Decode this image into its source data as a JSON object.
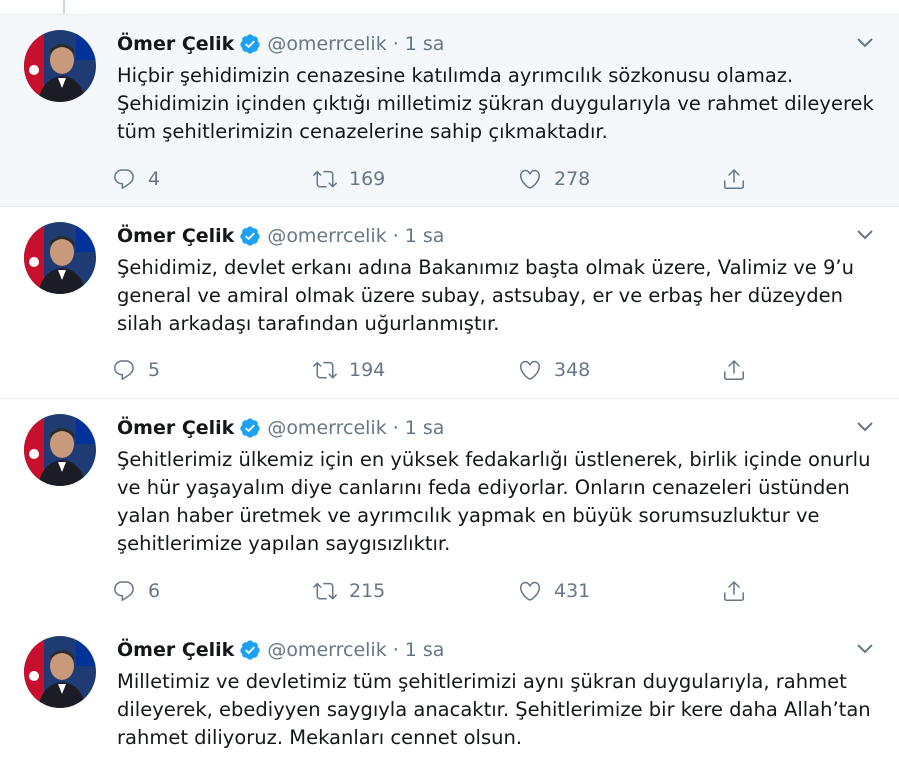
{
  "tweets": [
    {
      "author": "Ömer Çelik",
      "handle": "@omerrcelik",
      "separator": "·",
      "time": "1 sa",
      "text": [
        "Hiçbir şehidimizin cenazesine katılımda ayrımcılık sözkonusu olamaz.",
        "Şehidimizin içinden çıktığı milletimiz şükran duygularıyla ve rahmet dileyerek",
        "tüm şehitlerimizin cenazelerine sahip çıkmaktadır."
      ],
      "replies": "4",
      "retweets": "169",
      "likes": "278"
    },
    {
      "author": "Ömer Çelik",
      "handle": "@omerrcelik",
      "separator": "·",
      "time": "1 sa",
      "text": [
        "Şehidimiz, devlet erkanı adına Bakanımız başta olmak üzere, Valimiz ve 9’u",
        "general ve amiral olmak üzere subay, astsubay, er ve erbaş her düzeyden",
        "silah arkadaşı tarafından uğurlanmıştır."
      ],
      "replies": "5",
      "retweets": "194",
      "likes": "348"
    },
    {
      "author": "Ömer Çelik",
      "handle": "@omerrcelik",
      "separator": "·",
      "time": "1 sa",
      "text": [
        "Şehitlerimiz ülkemiz için en yüksek fedakarlığı üstlenerek, birlik içinde onurlu",
        "ve hür yaşayalım diye canlarını feda ediyorlar. Onların cenazeleri üstünden",
        "yalan haber üretmek ve ayrımcılık yapmak en büyük sorumsuzluktur ve",
        "şehitlerimize yapılan saygısızlıktır."
      ],
      "replies": "6",
      "retweets": "215",
      "likes": "431"
    },
    {
      "author": "Ömer Çelik",
      "handle": "@omerrcelik",
      "separator": "·",
      "time": "1 sa",
      "text": [
        "Milletimiz ve devletimiz tüm şehitlerimizi aynı şükran duygularıyla, rahmet",
        "dileyerek, ebediyyen saygıyla anacaktır. Şehitlerimize bir kere daha Allah’tan",
        "rahmet diliyoruz. Mekanları cennet olsun."
      ]
    }
  ],
  "icons": {
    "verified": "verified-badge-icon",
    "caret": "chevron-down-icon",
    "reply": "reply-icon",
    "retweet": "retweet-icon",
    "like": "heart-icon",
    "share": "share-icon"
  },
  "colors": {
    "verified": "#1da1f2",
    "muted": "#657786",
    "text": "#14171a",
    "hover_bg": "#f5f8fa"
  }
}
